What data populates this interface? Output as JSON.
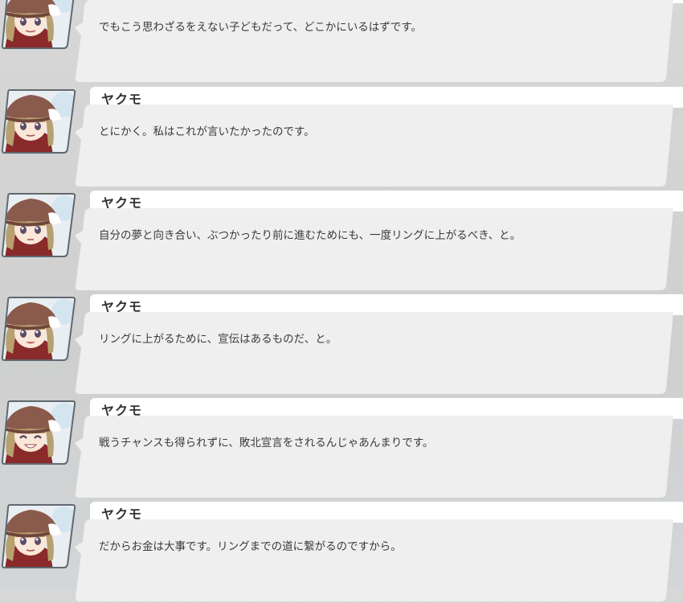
{
  "log": {
    "entries": [
      {
        "speaker": "",
        "text": "でもこう思わざるをえない子どもだって、どこかにいるはずです。"
      },
      {
        "speaker": "ヤクモ",
        "text": "とにかく。私はこれが言いたかったのです。"
      },
      {
        "speaker": "ヤクモ",
        "text": "自分の夢と向き合い、ぶつかったり前に進むためにも、一度リングに上がるべき、と。"
      },
      {
        "speaker": "ヤクモ",
        "text": "リングに上がるために、宣伝はあるものだ、と。"
      },
      {
        "speaker": "ヤクモ",
        "text": "戦うチャンスも得られずに、敗北宣言をされるんじゃあんまりです。"
      },
      {
        "speaker": "ヤクモ",
        "text": "だからお金は大事です。リングまでの道に繋がるのですから。"
      }
    ]
  },
  "colors": {
    "background": "#d4d4d4",
    "bubble": "#efefef",
    "speaker_bar": "#ffffff",
    "text": "#3a3a3a",
    "hat": "#8a5a4c",
    "hair": "#b8a070"
  }
}
